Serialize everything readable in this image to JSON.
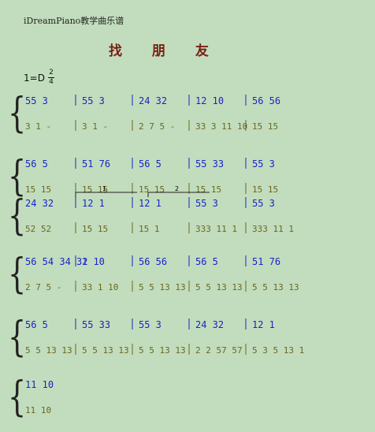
{
  "header": {
    "brand": "iDreamPiano教学曲乐谱"
  },
  "song": {
    "title": "找 朋 友",
    "key": "1=D",
    "time_top": "2",
    "time_bottom": "4"
  },
  "rows": [
    {
      "upper": [
        "55 3",
        "55 3",
        "24 32",
        "12 10",
        "56 56"
      ],
      "lower": [
        "3 1 -",
        "3 1 -",
        "2 7 5 -",
        "33 3 11 10",
        "15 15"
      ]
    },
    {
      "upper": [
        "56 5",
        "51 76",
        "56 5",
        "55 33",
        "55 3"
      ],
      "lower": [
        "15 15",
        "15 15",
        "15 15",
        "15 15",
        "15 15"
      ]
    },
    {
      "upper": [
        "24 32",
        "12 1",
        "12 1",
        "55 3",
        "55 3"
      ],
      "lower": [
        "52 52",
        "15 15",
        "15 1",
        "333 11 1",
        "333 11 1"
      ],
      "endings": [
        "1",
        "2"
      ]
    },
    {
      "upper": [
        "56 54 34 32",
        "1 10",
        "56 56",
        "56 5",
        "51 76"
      ],
      "lower": [
        "2 7 5 -",
        "33 1 10",
        "5 5 13 13",
        "5 5 13 13",
        "5 5 13 13"
      ]
    },
    {
      "upper": [
        "56 5",
        "55 33",
        "55 3",
        "24 32",
        "12 1"
      ],
      "lower": [
        "5 5 13 13",
        "5 5 13 13",
        "5 5 13 13",
        "2 2 57 57",
        "5 3 5 13 1"
      ]
    },
    {
      "upper": [
        "11 10"
      ],
      "lower": [
        "11 10"
      ]
    }
  ]
}
